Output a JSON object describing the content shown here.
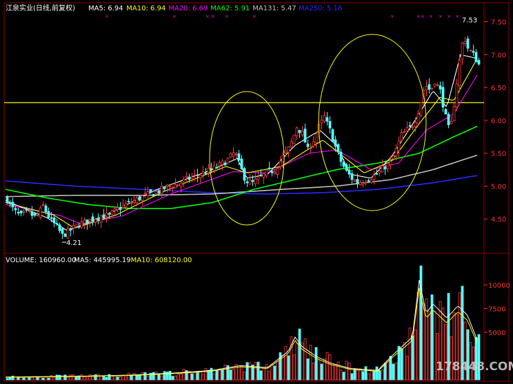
{
  "colors": {
    "up": "#ff3b3b",
    "down": "#54ffff",
    "ma5": "#ffffff",
    "ma10": "#ffff00",
    "ma20": "#ff00ff",
    "ma62": "#00ff00",
    "ma131": "#c0c0c0",
    "ma250": "#2a2aff",
    "support": "#ffff00",
    "ellipse": "#ffff00",
    "frame": "#8b0000",
    "tick": "#ff3333",
    "marker": "#ff00ff"
  },
  "price_panel": {
    "header": {
      "name": "江泉实业(日线,前复权)",
      "ma": [
        {
          "label": "MA5: 6.94",
          "color_key": "ma5"
        },
        {
          "label": "MA10: 6.94",
          "color_key": "ma10"
        },
        {
          "label": "MA20: 6.69",
          "color_key": "ma20"
        },
        {
          "label": "MA62: 5.91",
          "color_key": "ma62"
        },
        {
          "label": "MA131: 5.47",
          "color_key": "ma131"
        },
        {
          "label": "MA250: 5.16",
          "color_key": "ma250"
        }
      ]
    },
    "y_ticks": [
      "7.50",
      "7.00",
      "6.50",
      "6.00",
      "5.50",
      "5.00",
      "4.50"
    ],
    "annotations": {
      "low": "4.21",
      "high": "7.53"
    },
    "support_level": 6.27
  },
  "volume_panel": {
    "header": [
      {
        "label": "VOLUME: 160960.00",
        "color_key": "ma5"
      },
      {
        "label": "MA5: 445995.19",
        "color_key": "ma5"
      },
      {
        "label": "MA10: 608120.00",
        "color_key": "ma10"
      }
    ],
    "y_ticks": [
      "10000",
      "7500",
      "5000"
    ]
  },
  "watermark": "178448.COM",
  "chart_data": {
    "type": "candlestick",
    "y_range": [
      4.0,
      7.6
    ],
    "volume_range": [
      0,
      12600
    ],
    "candles_note": "series generated to match visible price path",
    "price_path": [
      [
        0,
        4.8
      ],
      [
        10,
        4.62
      ],
      [
        20,
        4.55
      ],
      [
        30,
        4.6
      ],
      [
        42,
        4.52
      ],
      [
        52,
        4.7
      ],
      [
        62,
        4.5
      ],
      [
        72,
        4.38
      ],
      [
        80,
        4.25
      ],
      [
        88,
        4.3
      ],
      [
        100,
        4.4
      ],
      [
        112,
        4.45
      ],
      [
        124,
        4.5
      ],
      [
        136,
        4.55
      ],
      [
        148,
        4.55
      ],
      [
        160,
        4.65
      ],
      [
        172,
        4.72
      ],
      [
        185,
        4.78
      ],
      [
        200,
        4.86
      ],
      [
        215,
        4.9
      ],
      [
        230,
        4.98
      ],
      [
        245,
        5.02
      ],
      [
        260,
        5.1
      ],
      [
        275,
        5.16
      ],
      [
        290,
        5.22
      ],
      [
        305,
        5.3
      ],
      [
        318,
        5.38
      ],
      [
        330,
        5.52
      ],
      [
        337,
        5.32
      ],
      [
        346,
        5.08
      ],
      [
        356,
        5.05
      ],
      [
        366,
        5.12
      ],
      [
        376,
        5.2
      ],
      [
        388,
        5.25
      ],
      [
        400,
        5.45
      ],
      [
        410,
        5.6
      ],
      [
        420,
        5.9
      ],
      [
        428,
        5.8
      ],
      [
        436,
        5.55
      ],
      [
        444,
        5.7
      ],
      [
        452,
        5.9
      ],
      [
        460,
        6.05
      ],
      [
        468,
        5.85
      ],
      [
        476,
        5.6
      ],
      [
        484,
        5.38
      ],
      [
        492,
        5.22
      ],
      [
        500,
        5.12
      ],
      [
        508,
        5.05
      ],
      [
        516,
        5.08
      ],
      [
        524,
        5.12
      ],
      [
        532,
        5.15
      ],
      [
        540,
        5.22
      ],
      [
        548,
        5.3
      ],
      [
        556,
        5.35
      ],
      [
        564,
        5.55
      ],
      [
        572,
        5.78
      ],
      [
        580,
        5.85
      ],
      [
        590,
        5.95
      ],
      [
        598,
        6.2
      ],
      [
        606,
        6.55
      ],
      [
        614,
        6.45
      ],
      [
        620,
        6.6
      ],
      [
        628,
        6.45
      ],
      [
        636,
        6.05
      ],
      [
        642,
        5.8
      ],
      [
        648,
        6.25
      ],
      [
        656,
        6.9
      ],
      [
        662,
        7.3
      ],
      [
        668,
        7.1
      ],
      [
        676,
        7.0
      ],
      [
        684,
        6.85
      ]
    ],
    "ma_series": {
      "ma5": [
        [
          0,
          4.78
        ],
        [
          60,
          4.52
        ],
        [
          90,
          4.32
        ],
        [
          150,
          4.58
        ],
        [
          220,
          4.95
        ],
        [
          300,
          5.25
        ],
        [
          336,
          5.42
        ],
        [
          350,
          5.12
        ],
        [
          380,
          5.18
        ],
        [
          420,
          5.62
        ],
        [
          456,
          5.85
        ],
        [
          480,
          5.62
        ],
        [
          500,
          5.18
        ],
        [
          530,
          5.12
        ],
        [
          560,
          5.45
        ],
        [
          600,
          6.1
        ],
        [
          620,
          6.45
        ],
        [
          640,
          6.2
        ],
        [
          660,
          7.0
        ],
        [
          684,
          6.94
        ]
      ],
      "ma10": [
        [
          0,
          4.75
        ],
        [
          70,
          4.56
        ],
        [
          100,
          4.36
        ],
        [
          160,
          4.56
        ],
        [
          230,
          4.92
        ],
        [
          320,
          5.3
        ],
        [
          350,
          5.2
        ],
        [
          400,
          5.3
        ],
        [
          460,
          5.7
        ],
        [
          490,
          5.45
        ],
        [
          520,
          5.2
        ],
        [
          560,
          5.38
        ],
        [
          600,
          5.95
        ],
        [
          630,
          6.35
        ],
        [
          650,
          6.3
        ],
        [
          684,
          6.94
        ]
      ],
      "ma20": [
        [
          0,
          4.72
        ],
        [
          80,
          4.55
        ],
        [
          110,
          4.42
        ],
        [
          170,
          4.55
        ],
        [
          240,
          4.88
        ],
        [
          330,
          5.22
        ],
        [
          380,
          5.2
        ],
        [
          440,
          5.5
        ],
        [
          480,
          5.55
        ],
        [
          530,
          5.25
        ],
        [
          570,
          5.35
        ],
        [
          610,
          5.85
        ],
        [
          650,
          6.1
        ],
        [
          684,
          6.69
        ]
      ],
      "ma62": [
        [
          0,
          4.95
        ],
        [
          60,
          4.82
        ],
        [
          120,
          4.72
        ],
        [
          180,
          4.66
        ],
        [
          240,
          4.66
        ],
        [
          300,
          4.75
        ],
        [
          360,
          4.95
        ],
        [
          420,
          5.1
        ],
        [
          480,
          5.25
        ],
        [
          540,
          5.35
        ],
        [
          600,
          5.5
        ],
        [
          650,
          5.75
        ],
        [
          684,
          5.91
        ]
      ],
      "ma131": [
        [
          0,
          4.84
        ],
        [
          100,
          4.86
        ],
        [
          200,
          4.86
        ],
        [
          300,
          4.88
        ],
        [
          400,
          4.95
        ],
        [
          480,
          5.0
        ],
        [
          560,
          5.1
        ],
        [
          620,
          5.25
        ],
        [
          684,
          5.47
        ]
      ],
      "ma250": [
        [
          0,
          5.08
        ],
        [
          100,
          5.0
        ],
        [
          200,
          4.95
        ],
        [
          300,
          4.9
        ],
        [
          380,
          4.88
        ],
        [
          460,
          4.9
        ],
        [
          540,
          4.95
        ],
        [
          620,
          5.05
        ],
        [
          684,
          5.16
        ]
      ]
    },
    "volume_path": [
      [
        0,
        300
      ],
      [
        60,
        350
      ],
      [
        120,
        400
      ],
      [
        180,
        500
      ],
      [
        240,
        700
      ],
      [
        300,
        1000
      ],
      [
        340,
        1500
      ],
      [
        380,
        1300
      ],
      [
        410,
        3000
      ],
      [
        420,
        4500
      ],
      [
        430,
        3500
      ],
      [
        450,
        2500
      ],
      [
        470,
        1800
      ],
      [
        500,
        1200
      ],
      [
        540,
        1000
      ],
      [
        560,
        2500
      ],
      [
        590,
        4500
      ],
      [
        600,
        10500
      ],
      [
        610,
        7000
      ],
      [
        620,
        8000
      ],
      [
        640,
        6500
      ],
      [
        656,
        7800
      ],
      [
        670,
        6800
      ],
      [
        684,
        4200
      ]
    ]
  }
}
